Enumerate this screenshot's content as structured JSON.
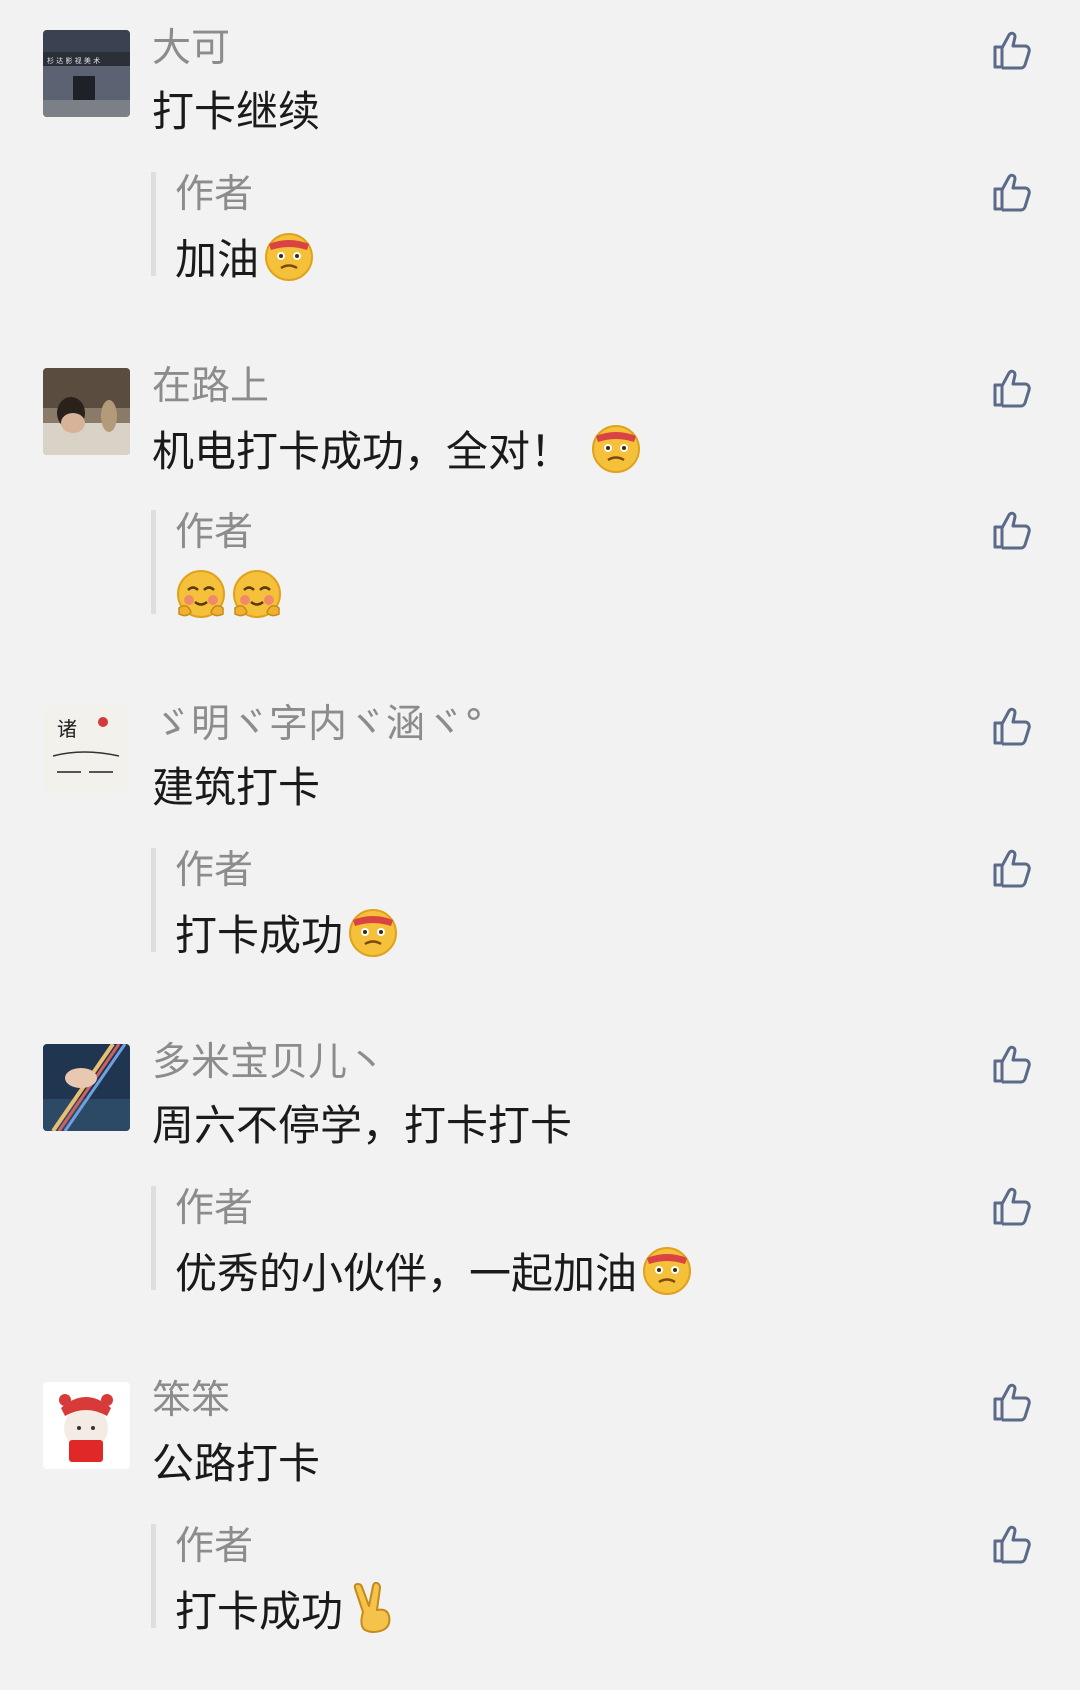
{
  "threads": [
    {
      "user": "大可",
      "comment": "打卡继续",
      "comment_emoji": "",
      "reply_author": "作者",
      "reply": "加油",
      "reply_emoji": [
        "angry-face-emoji"
      ]
    },
    {
      "user": "在路上",
      "comment": "机电打卡成功，全对！",
      "comment_emoji": "angry-face-emoji",
      "reply_author": "作者",
      "reply": "",
      "reply_emoji": [
        "blush-face-emoji",
        "blush-face-emoji"
      ]
    },
    {
      "user": "ゞ明ヾ字内ヾ涵ヾ°",
      "comment": "建筑打卡",
      "comment_emoji": "",
      "reply_author": "作者",
      "reply": "打卡成功",
      "reply_emoji": [
        "angry-face-emoji"
      ]
    },
    {
      "user": "多米宝贝儿丶",
      "comment": "周六不停学，打卡打卡",
      "comment_emoji": "",
      "reply_author": "作者",
      "reply": "优秀的小伙伴，一起加油",
      "reply_emoji": [
        "angry-face-emoji"
      ]
    },
    {
      "user": "笨笨",
      "comment": "公路打卡",
      "comment_emoji": "",
      "reply_author": "作者",
      "reply": "打卡成功",
      "reply_emoji": [
        "victory-hand-emoji"
      ]
    }
  ],
  "icons": {
    "like": "thumbs-up-icon"
  },
  "colors": {
    "background": "#f2f2f2",
    "name_text": "#8c8c8c",
    "body_text": "#1a1a1a",
    "reply_bar": "#dedede"
  }
}
